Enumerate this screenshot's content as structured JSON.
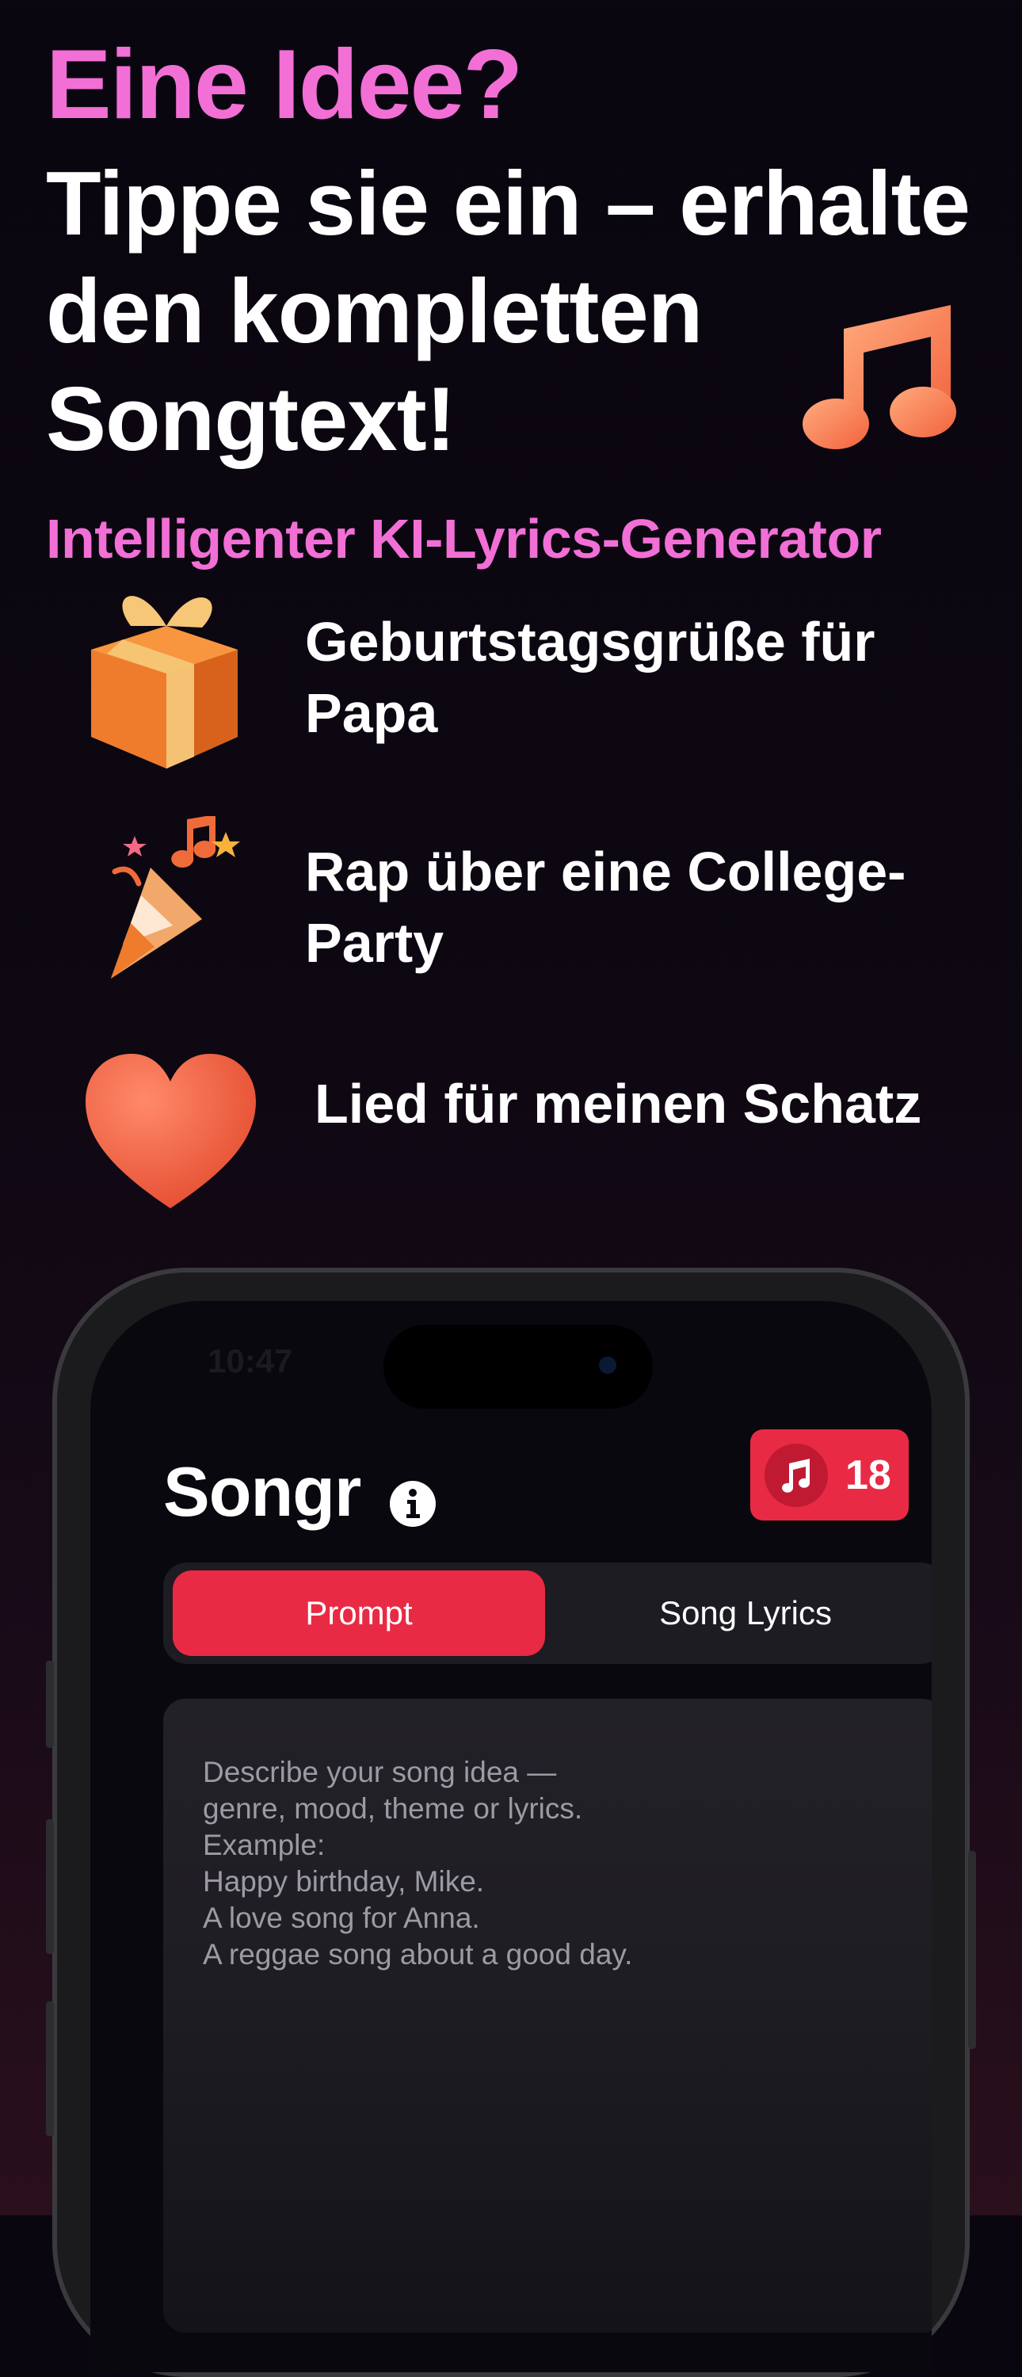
{
  "hero": {
    "line1": "Eine Idee?",
    "line2": "Tippe sie ein – erhalte den kompletten Songtext!",
    "subtitle": "Intelligenter KI-Lyrics-Generator"
  },
  "examples": [
    {
      "icon": "gift-icon",
      "text": "Geburtstagsgrüße für Papa"
    },
    {
      "icon": "party-popper-icon",
      "text": "Rap über eine College-Party"
    },
    {
      "icon": "heart-icon",
      "text": "Lied für meinen Schatz"
    }
  ],
  "phone": {
    "status_time": "10:47",
    "app_title": "Songr",
    "badge_count": "18",
    "tabs": [
      "Prompt",
      "Song Lyrics"
    ],
    "active_tab": "Prompt",
    "prompt_placeholder": "Describe your song idea —\ngenre, mood, theme or lyrics.\nExample:\nHappy birthday, Mike.\nA love song for Anna.\nA reggae song about a good day."
  },
  "colors": {
    "accent_pink": "#f26fd6",
    "accent_red": "#e92a44",
    "background": "#0a0610"
  }
}
